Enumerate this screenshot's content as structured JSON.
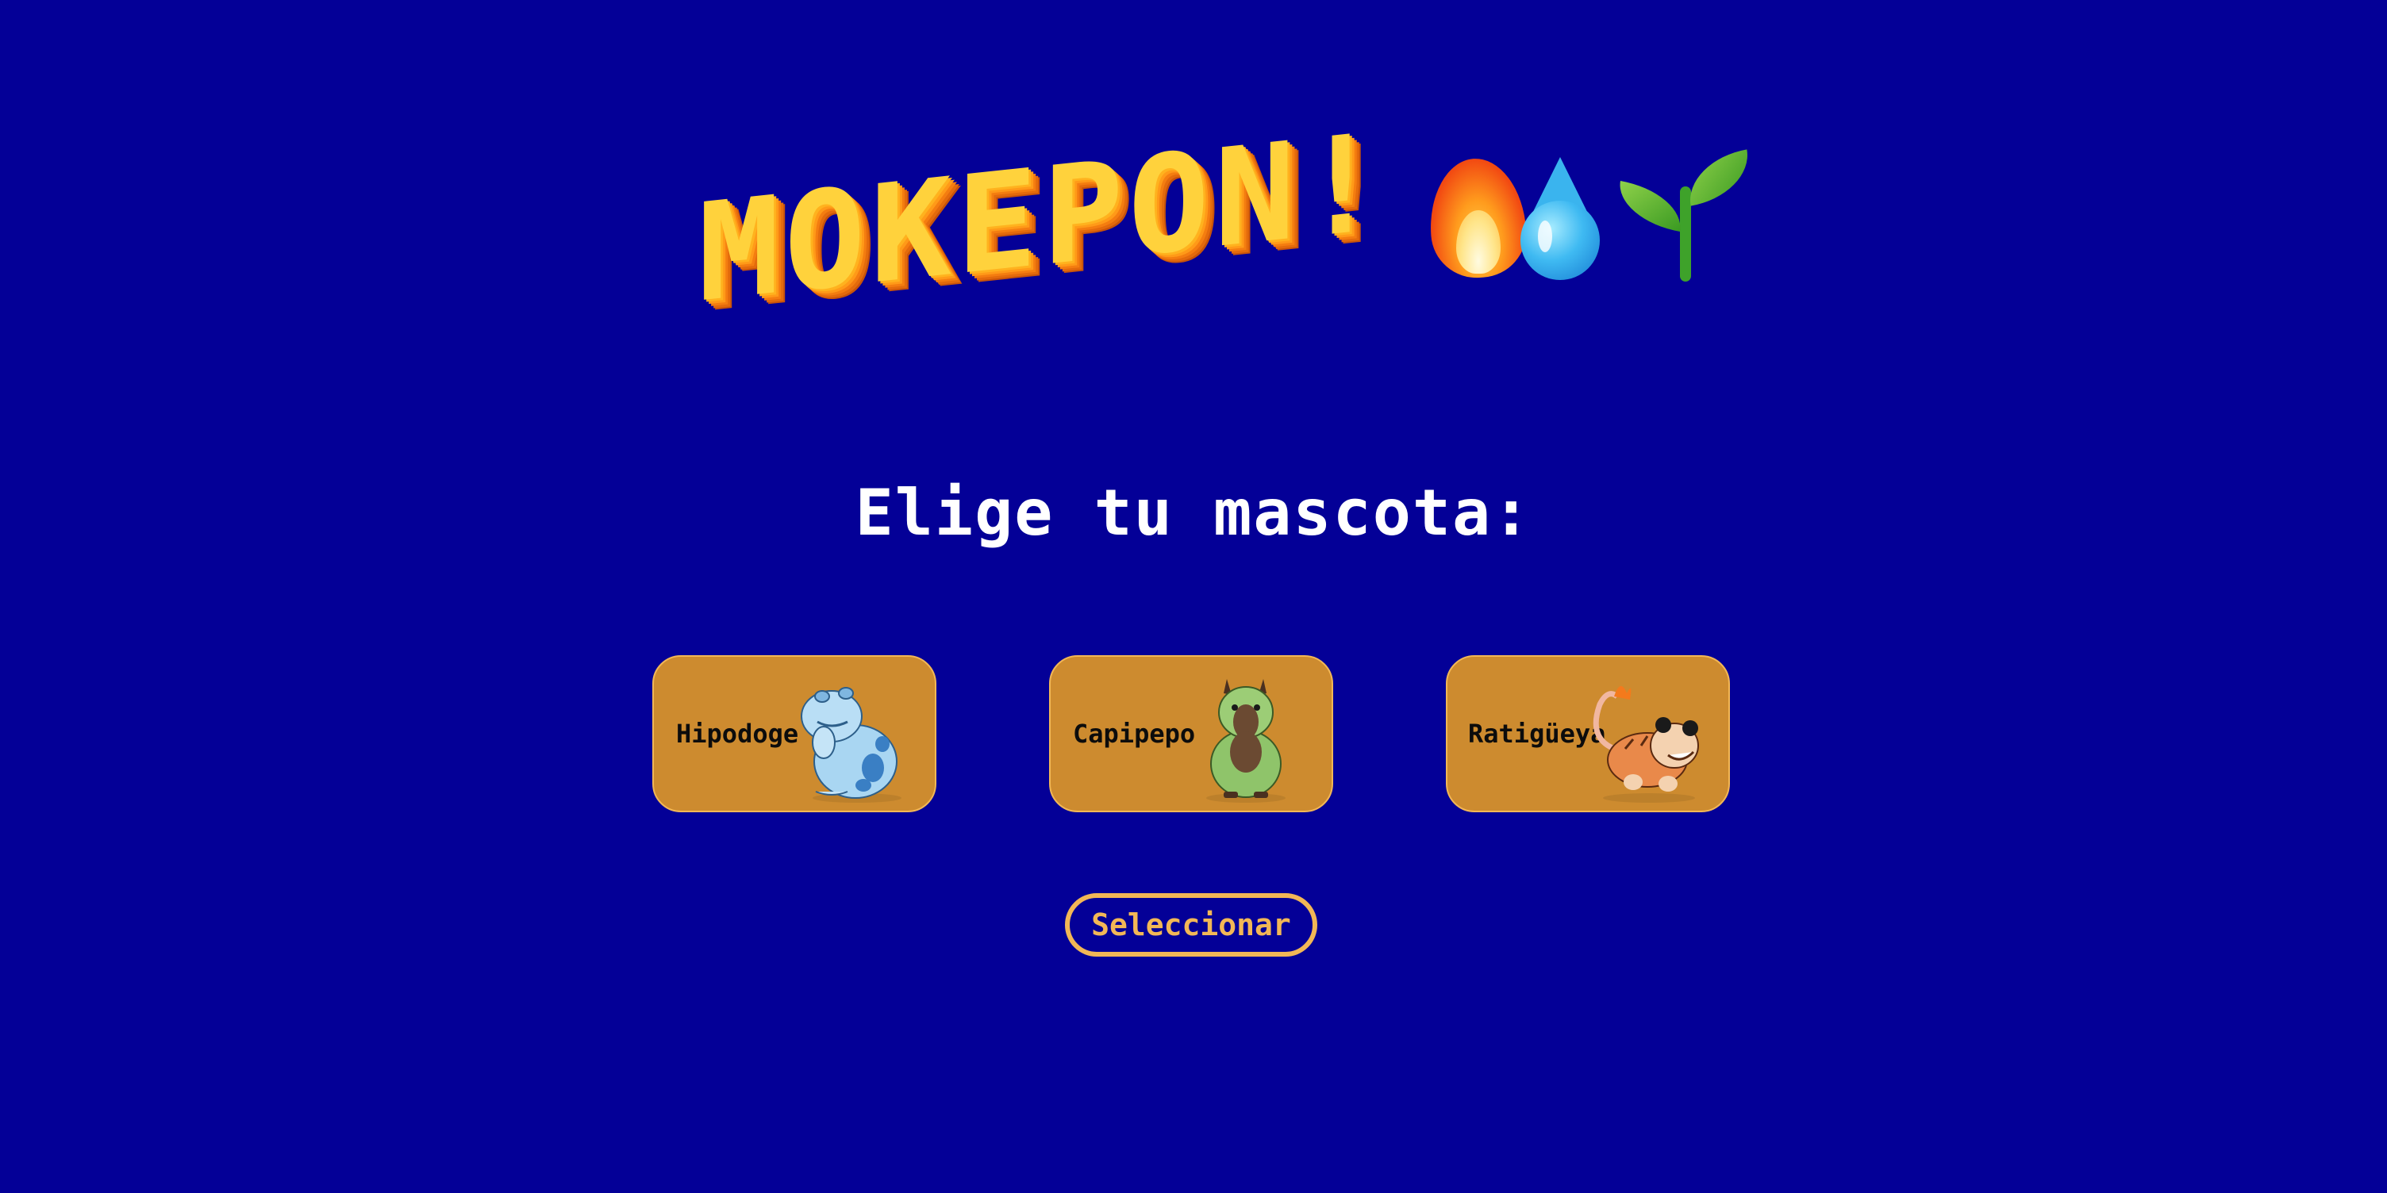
{
  "header": {
    "logo_text": "MOKEPON!",
    "icons": [
      "fire-icon",
      "water-drop-icon",
      "sprout-icon"
    ]
  },
  "subtitle": "Elige tu mascota:",
  "pets": [
    {
      "label": "Hipodoge",
      "icon": "hipodoge-icon"
    },
    {
      "label": "Capipepo",
      "icon": "capipepo-icon"
    },
    {
      "label": "Ratigüeya",
      "icon": "ratigueya-icon"
    }
  ],
  "select_button": {
    "label": "Seleccionar"
  },
  "colors": {
    "background": "#040097",
    "card": "#cd8b2f",
    "accent": "#f2b756",
    "logo": "#ffd23c",
    "text_light": "#ffffff"
  }
}
